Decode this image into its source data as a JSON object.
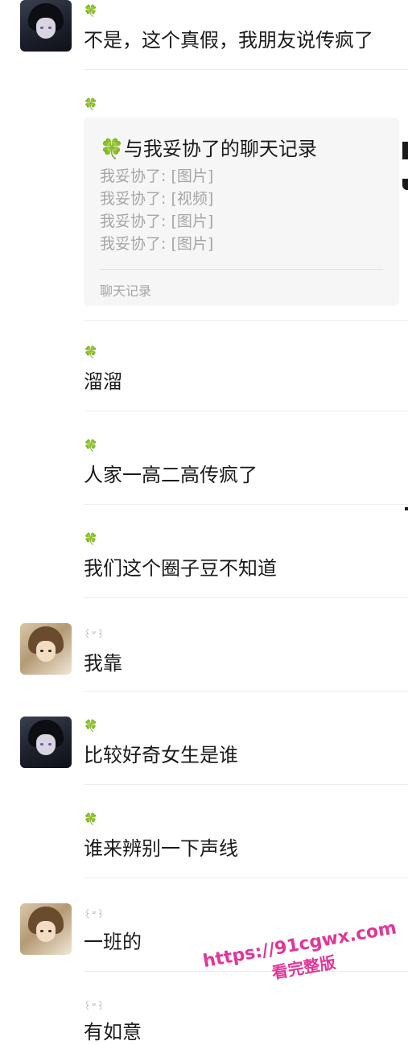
{
  "nick_clover": "🍀",
  "nick_cat": "꒰ᐡ꒱",
  "messages": [
    {
      "text": "不是，这个真假，我朋友说传疯了"
    },
    {
      "card": {
        "title": "🍀与我妥协了的聊天记录",
        "items": [
          "我妥协了: [图片]",
          "我妥协了: [视频]",
          "我妥协了: [图片]",
          "我妥协了: [图片]"
        ],
        "footer": "聊天记录"
      }
    },
    {
      "text": "溜溜"
    },
    {
      "text": "人家一高二高传疯了"
    },
    {
      "text": "我们这个圈子豆不知道"
    },
    {
      "text": "我靠"
    },
    {
      "text": "比较好奇女生是谁"
    },
    {
      "text": "谁来辨别一下声线"
    },
    {
      "text": "一班的"
    },
    {
      "text": "有如意"
    }
  ],
  "watermark": {
    "url": "https://91cgwx.com",
    "subtitle": "看完整版"
  }
}
